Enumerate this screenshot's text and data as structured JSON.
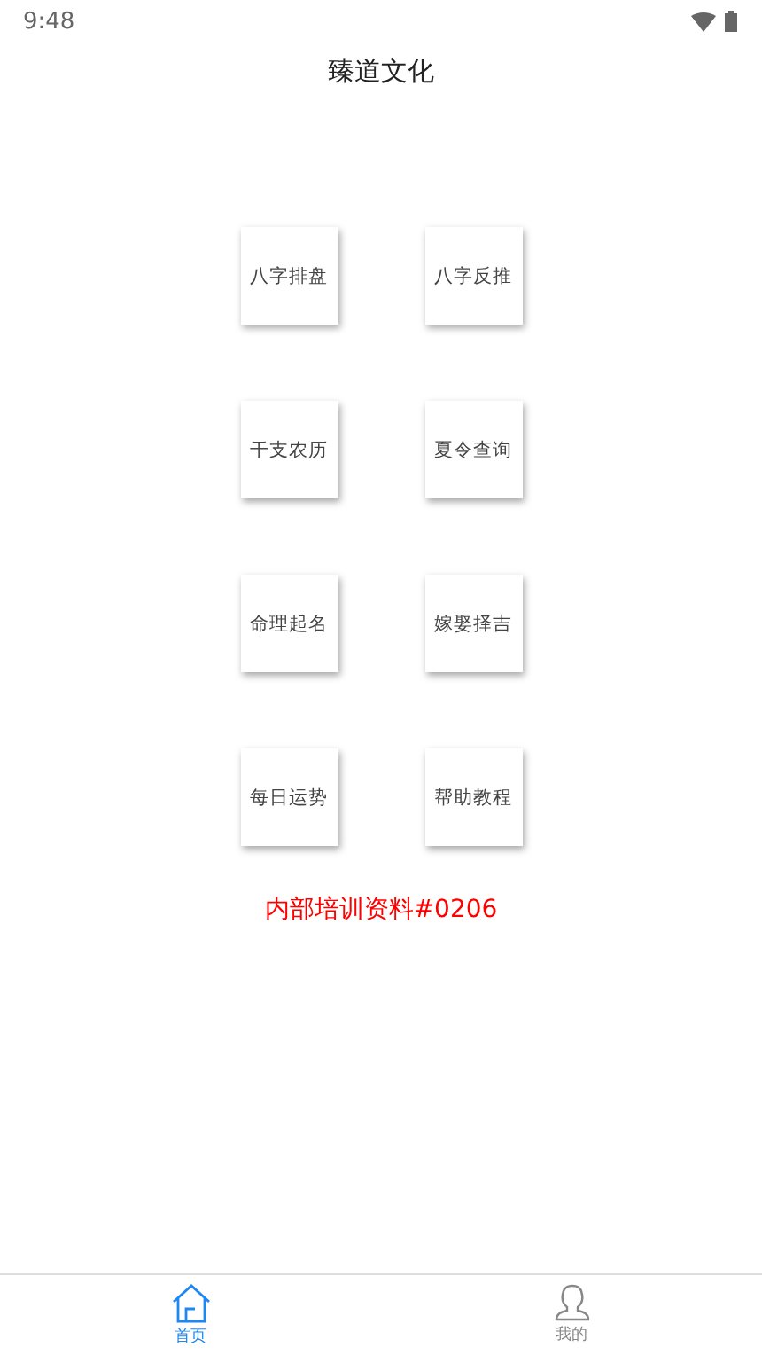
{
  "status_bar": {
    "time": "9:48"
  },
  "header": {
    "title": "臻道文化"
  },
  "tiles": [
    {
      "label": "八字排盘"
    },
    {
      "label": "八字反推"
    },
    {
      "label": "干支农历"
    },
    {
      "label": "夏令查询"
    },
    {
      "label": "命理起名"
    },
    {
      "label": "嫁娶择吉"
    },
    {
      "label": "每日运势"
    },
    {
      "label": "帮助教程"
    }
  ],
  "notice": "内部培训资料#0206",
  "tab_bar": [
    {
      "label": "首页",
      "kind": "home",
      "selected": true
    },
    {
      "label": "我的",
      "kind": "person",
      "selected": false
    }
  ]
}
